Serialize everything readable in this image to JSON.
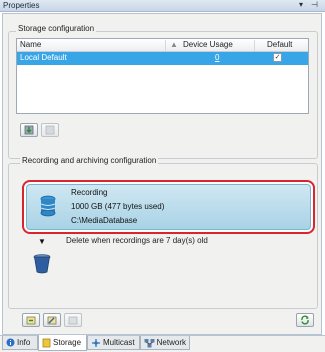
{
  "window": {
    "title": "Properties",
    "pin_icon": "dropdown-arrow-icon",
    "close_icon": "pin-icon"
  },
  "storage": {
    "group_label": "Storage configuration",
    "columns": [
      "Name",
      "Device Usage",
      "Default"
    ],
    "rows": [
      {
        "name": "Local Default",
        "device_usage": "0",
        "default": true
      }
    ],
    "buttons": [
      "add-storage-icon",
      "remove-storage-icon"
    ]
  },
  "recording": {
    "group_label": "Recording and archiving configuration",
    "title": "Recording",
    "size_line": "1000 GB (477 bytes used)",
    "path": "C:\\MediaDatabase",
    "delete_text": "Delete when recordings are 7 day(s) old"
  },
  "bottom_buttons": [
    "add-archive-icon",
    "edit-archive-icon",
    "remove-archive-icon",
    "refresh-icon"
  ],
  "tabs": [
    {
      "label": "Info",
      "icon": "info-icon",
      "active": false
    },
    {
      "label": "Storage",
      "icon": "storage-icon",
      "active": true
    },
    {
      "label": "Multicast",
      "icon": "multicast-icon",
      "active": false
    },
    {
      "label": "Network",
      "icon": "network-icon",
      "active": false
    }
  ]
}
